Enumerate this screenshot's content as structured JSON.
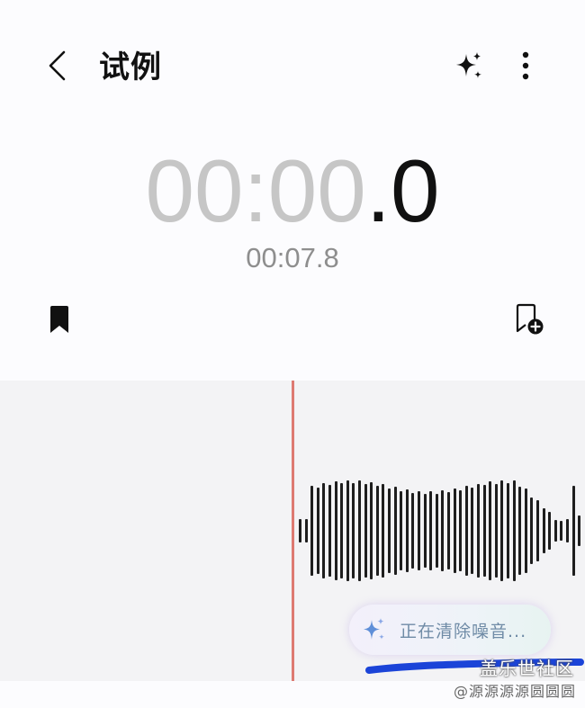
{
  "header": {
    "title": "试例",
    "back_icon": "chevron-left-icon",
    "ai_icon": "sparkle-icon",
    "more_icon": "more-vertical-icon"
  },
  "timer": {
    "elapsed_main": "00:00",
    "elapsed_fraction": ".0",
    "total": "00:07.8"
  },
  "actions": {
    "bookmark_icon": "bookmark-icon",
    "add_bookmark_icon": "bookmark-add-icon"
  },
  "noise_reduction": {
    "label": "正在清除噪音...",
    "icon": "sparkle-icon"
  },
  "watermark": {
    "line1": "盖乐世社区",
    "line2": "@源源源源圆圆圆"
  },
  "colors": {
    "playhead": "#dd7a72",
    "waveform": "#1e1e1e",
    "timer_dim": "#c6c6c6",
    "pill_text": "#6f8ba6",
    "scribble": "#1b44d8"
  }
}
